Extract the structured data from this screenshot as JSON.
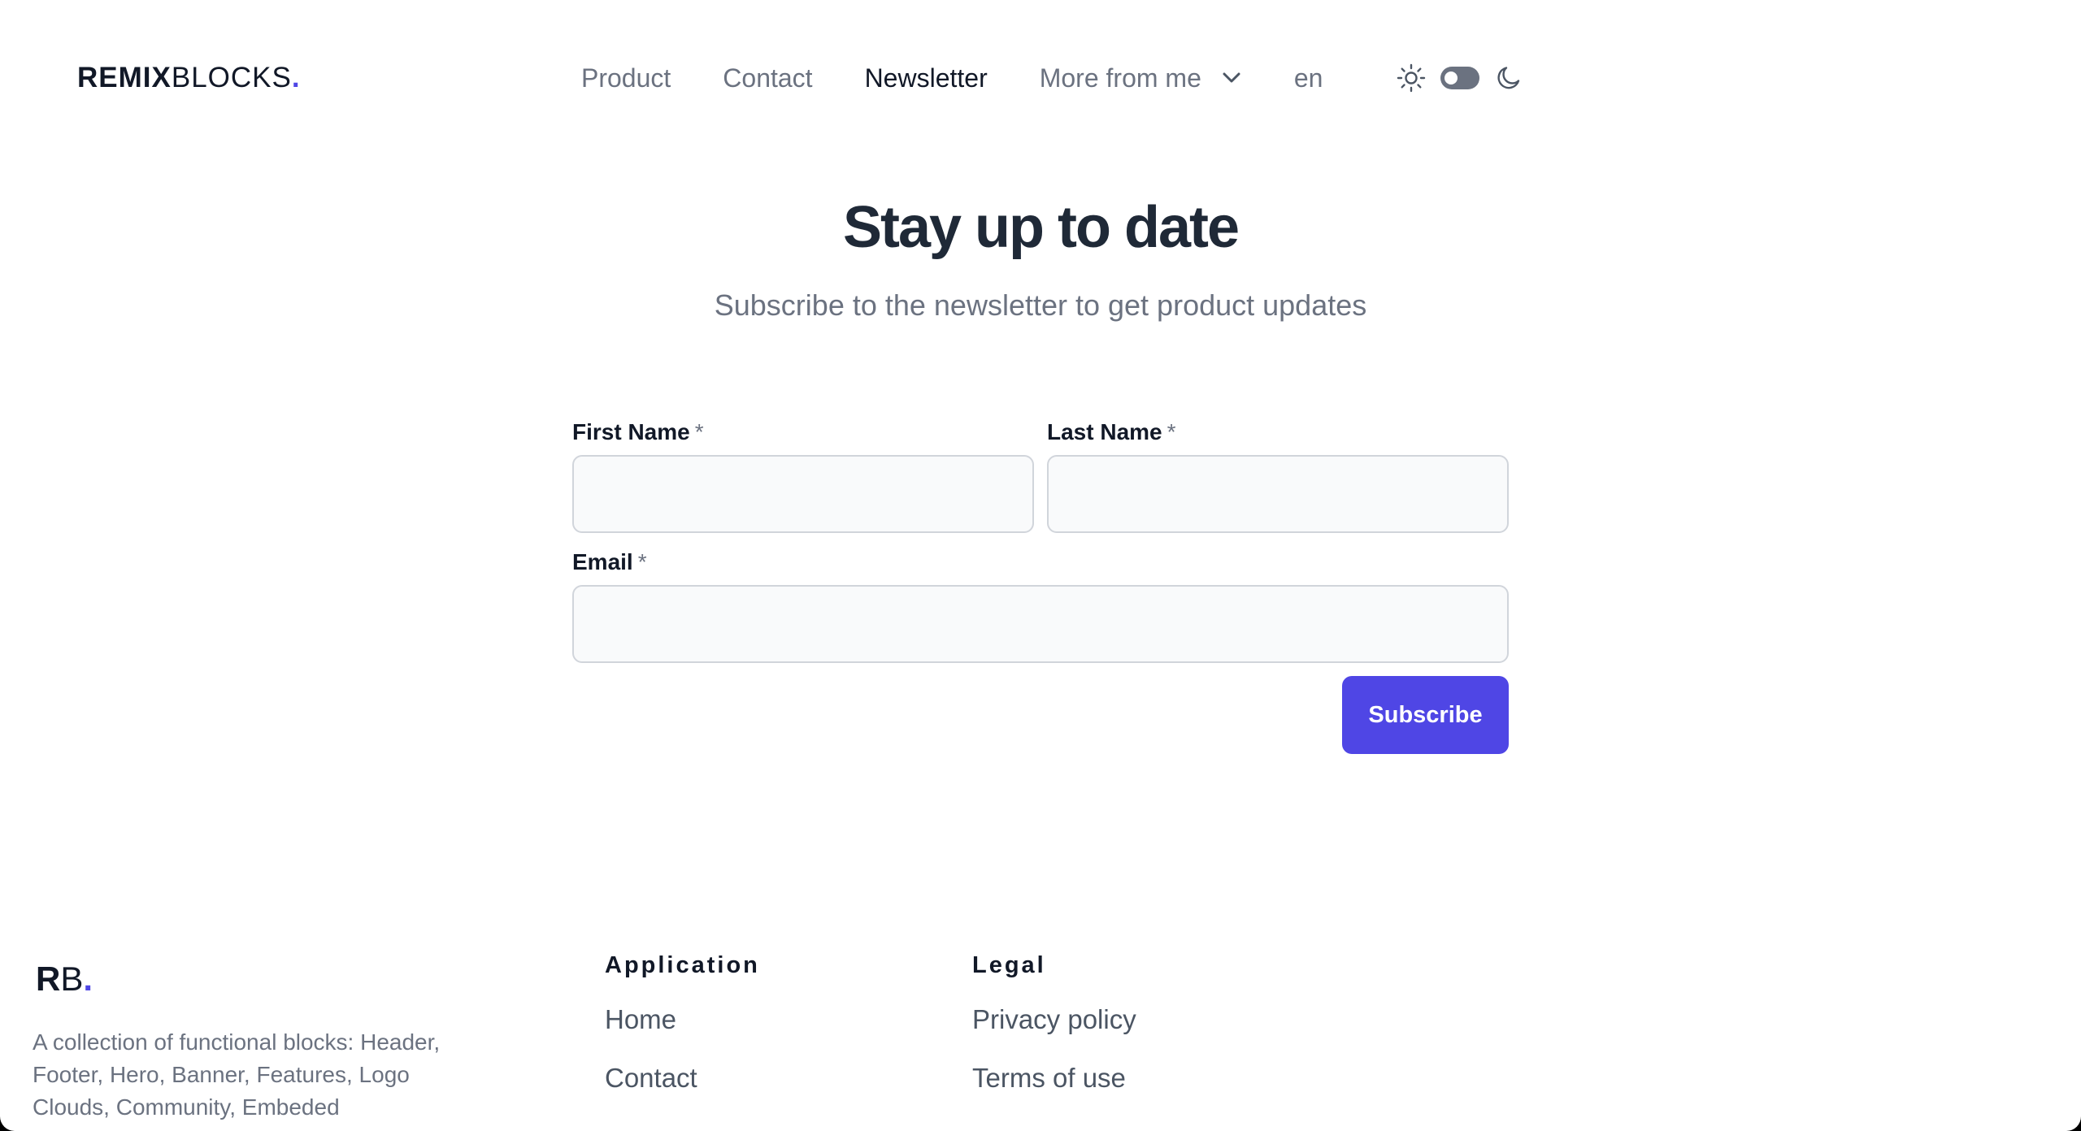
{
  "header": {
    "logo_bold": "REMIX",
    "logo_light": "BLOCKS",
    "logo_dot": ".",
    "nav": [
      {
        "label": "Product",
        "active": false
      },
      {
        "label": "Contact",
        "active": false
      },
      {
        "label": "Newsletter",
        "active": true
      }
    ],
    "more_label": "More from me",
    "language": "en",
    "theme_icons": [
      "sun-icon",
      "moon-icon"
    ]
  },
  "hero": {
    "title": "Stay up to date",
    "subtitle": "Subscribe to the newsletter to get product updates"
  },
  "form": {
    "first_name_label": "First Name",
    "last_name_label": "Last Name",
    "email_label": "Email",
    "required_mark": "*",
    "first_name_value": "",
    "last_name_value": "",
    "email_value": "",
    "submit_label": "Subscribe"
  },
  "footer": {
    "logo_r": "R",
    "logo_b": "B",
    "logo_dot": ".",
    "description": "A collection of functional blocks: Header, Footer, Hero, Banner, Features, Logo Clouds, Community, Embeded",
    "columns": [
      {
        "title": "Application",
        "links": [
          "Home",
          "Contact"
        ]
      },
      {
        "title": "Legal",
        "links": [
          "Privacy policy",
          "Terms of use"
        ]
      }
    ]
  },
  "colors": {
    "accent": "#4f46e5",
    "heading": "#1f2937",
    "muted": "#6b7280",
    "input_bg": "#f9fafb",
    "input_border": "#d1d5db"
  }
}
